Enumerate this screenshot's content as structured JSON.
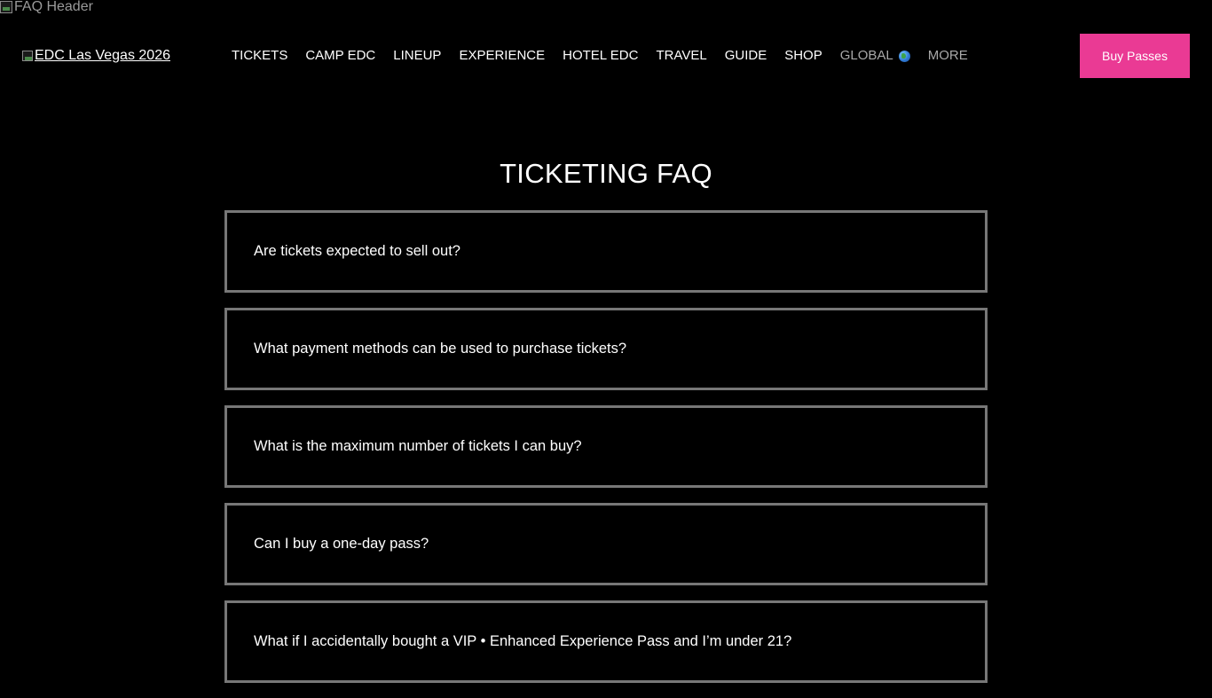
{
  "header_image": {
    "alt": "FAQ Header"
  },
  "logo": {
    "alt": "EDC Las Vegas 2026"
  },
  "nav": {
    "items": [
      {
        "label": "TICKETS"
      },
      {
        "label": "CAMP EDC"
      },
      {
        "label": "LINEUP"
      },
      {
        "label": "EXPERIENCE"
      },
      {
        "label": "HOTEL EDC"
      },
      {
        "label": "TRAVEL"
      },
      {
        "label": "GUIDE"
      },
      {
        "label": "SHOP"
      },
      {
        "label": "GLOBAL"
      },
      {
        "label": "MORE"
      }
    ],
    "global_icon": "globe-icon"
  },
  "cta": {
    "buy_label": "Buy Passes",
    "color": "#ea3a94"
  },
  "page": {
    "title": "TICKETING FAQ"
  },
  "faq": {
    "items": [
      {
        "question": "Are tickets expected to sell out?"
      },
      {
        "question": "What payment methods can be used to purchase tickets?"
      },
      {
        "question": "What is the maximum number of tickets I can buy?"
      },
      {
        "question": "Can I buy a one-day pass?"
      },
      {
        "question": "What if I accidentally bought a VIP • Enhanced Experience Pass and I’m under 21?"
      }
    ]
  }
}
